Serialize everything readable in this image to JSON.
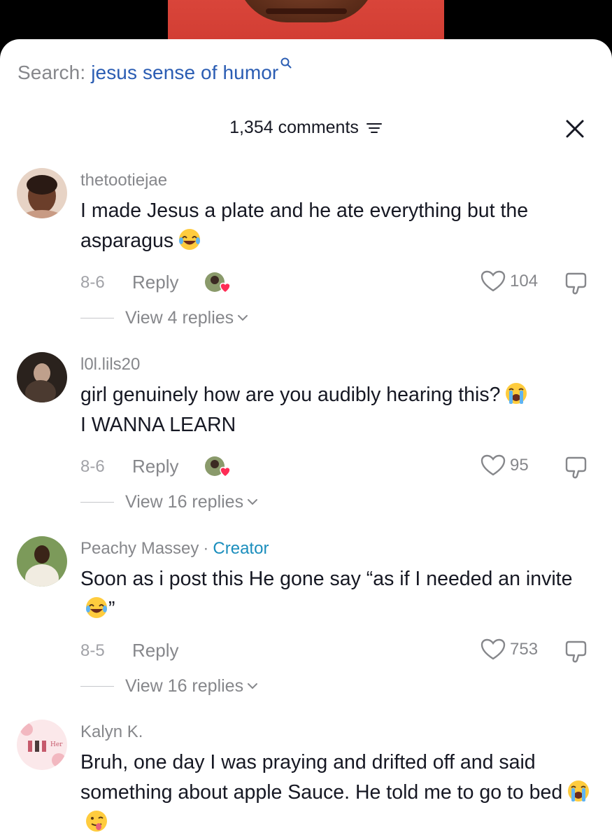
{
  "search": {
    "prefix": "Search:",
    "query": "jesus sense of humor"
  },
  "header": {
    "comment_count": "1,354 comments"
  },
  "comments": [
    {
      "username": "thetootiejae",
      "text": "I made Jesus a plate and he ate everything but the asparagus",
      "emojis": [
        "joy-emoji"
      ],
      "date": "8-6",
      "reply_label": "Reply",
      "likes": "104",
      "view_replies": "View 4 replies"
    },
    {
      "username": "l0l.lils20",
      "text": "girl genuinely how are you audibly hearing this?",
      "text2": "I WANNA LEARN",
      "emojis": [
        "loudly-crying-emoji"
      ],
      "date": "8-6",
      "reply_label": "Reply",
      "likes": "95",
      "view_replies": "View 16 replies"
    },
    {
      "username": "Peachy Massey",
      "badge": "Creator",
      "text": "Soon as i post this He gone say “as if I needed an invite",
      "text_end": "”",
      "emojis": [
        "joy-emoji"
      ],
      "date": "8-5",
      "reply_label": "Reply",
      "likes": "753",
      "view_replies": "View 16 replies"
    },
    {
      "username": "Kalyn K.",
      "text": "Bruh, one day I was praying and drifted off and said something about apple Sauce. He told me to go to bed",
      "emojis": [
        "loudly-crying-emoji",
        "face-with-tongue-emoji"
      ]
    }
  ],
  "colors": {
    "link": "#2b5db3",
    "creator": "#1b8ebd",
    "muted": "#86878b",
    "heart": "#fe2c55"
  }
}
